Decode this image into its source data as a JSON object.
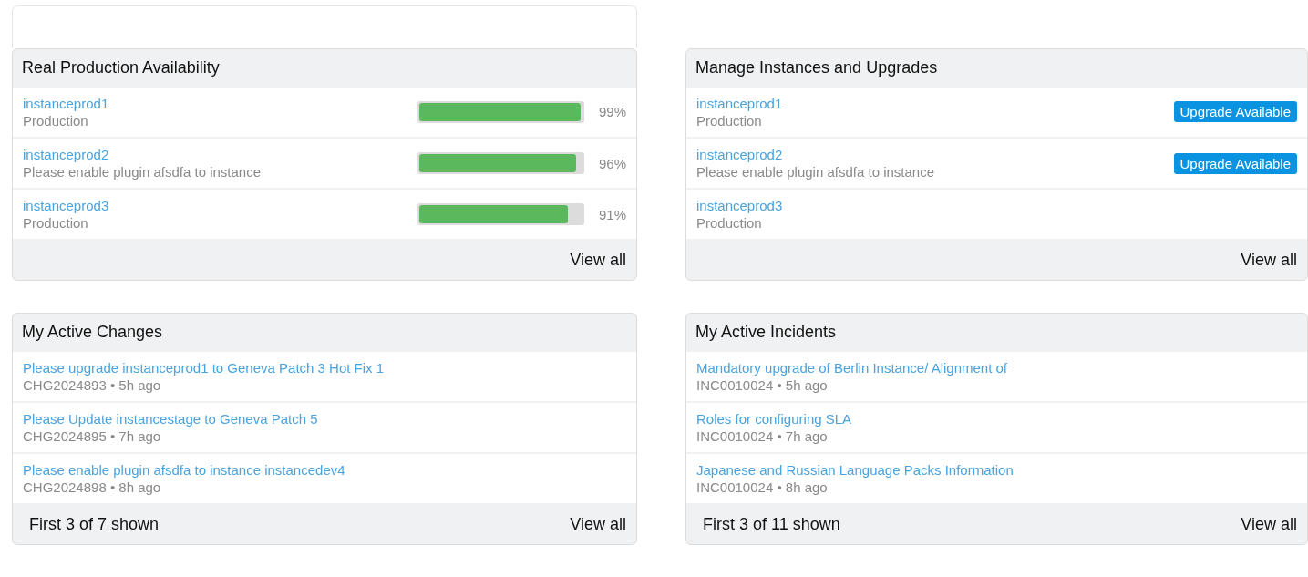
{
  "panels": [
    {
      "kind": "availability",
      "title": "Real Production Availability",
      "rows": [
        {
          "name": "instanceprod1",
          "detail": "Production",
          "level": 0.99,
          "reading": "99%"
        },
        {
          "name": "instanceprod2",
          "detail": "Please enable plugin afsdfa to instance",
          "level": 0.96,
          "reading": "96%"
        },
        {
          "name": "instanceprod3",
          "detail": "Production",
          "level": 0.91,
          "reading": "91%"
        }
      ],
      "footer": {
        "view_all": "View all"
      }
    },
    {
      "kind": "upgrades",
      "title": "Manage Instances and Upgrades",
      "rows": [
        {
          "name": "instanceprod1",
          "detail": "Production",
          "badge": "Upgrade Available"
        },
        {
          "name": "instanceprod2",
          "detail": "Please enable plugin afsdfa to instance",
          "badge": "Upgrade Available"
        },
        {
          "name": "instanceprod3",
          "detail": "Production"
        }
      ],
      "footer": {
        "view_all": "View all"
      }
    },
    {
      "kind": "list",
      "title": "My Active Changes",
      "rows": [
        {
          "name": "Please upgrade instanceprod1 to Geneva Patch 3 Hot Fix 1",
          "detail": "CHG2024893 • 5h ago"
        },
        {
          "name": "Please Update instancestage to Geneva Patch 5",
          "detail": "CHG2024895 • 7h ago"
        },
        {
          "name": "Please enable plugin afsdfa to instance instancedev4",
          "detail": "CHG2024898 • 8h ago"
        }
      ],
      "footer": {
        "summary": "First 3 of 7 shown",
        "view_all": "View all"
      }
    },
    {
      "kind": "list",
      "title": "My Active Incidents",
      "rows": [
        {
          "name": "Mandatory upgrade of Berlin Instance/ Alignment of",
          "detail": "INC0010024 • 5h ago"
        },
        {
          "name": "Roles for configuring SLA",
          "detail": "INC0010024 • 7h ago"
        },
        {
          "name": "Japanese and Russian Language Packs Information",
          "detail": "INC0010024 • 8h ago"
        }
      ],
      "footer": {
        "summary": "First 3 of 11 shown",
        "view_all": "View all"
      }
    }
  ]
}
